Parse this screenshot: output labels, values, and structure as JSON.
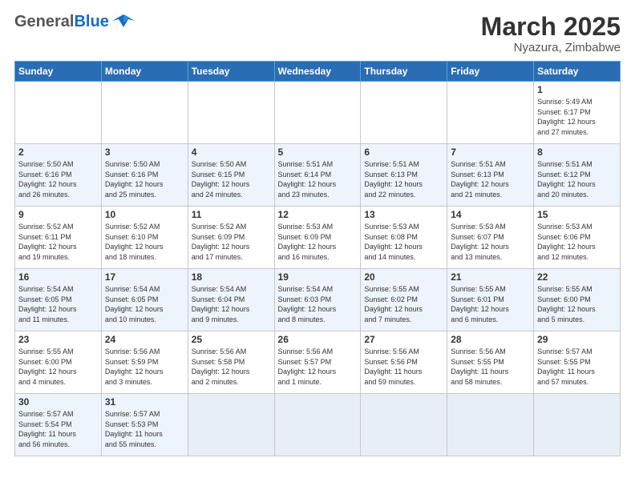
{
  "header": {
    "logo_general": "General",
    "logo_blue": "Blue",
    "title": "March 2025",
    "location": "Nyazura, Zimbabwe"
  },
  "weekdays": [
    "Sunday",
    "Monday",
    "Tuesday",
    "Wednesday",
    "Thursday",
    "Friday",
    "Saturday"
  ],
  "weeks": [
    [
      {
        "day": "",
        "info": ""
      },
      {
        "day": "",
        "info": ""
      },
      {
        "day": "",
        "info": ""
      },
      {
        "day": "",
        "info": ""
      },
      {
        "day": "",
        "info": ""
      },
      {
        "day": "",
        "info": ""
      },
      {
        "day": "1",
        "info": "Sunrise: 5:49 AM\nSunset: 6:17 PM\nDaylight: 12 hours\nand 27 minutes."
      }
    ],
    [
      {
        "day": "2",
        "info": "Sunrise: 5:50 AM\nSunset: 6:16 PM\nDaylight: 12 hours\nand 26 minutes."
      },
      {
        "day": "3",
        "info": "Sunrise: 5:50 AM\nSunset: 6:16 PM\nDaylight: 12 hours\nand 25 minutes."
      },
      {
        "day": "4",
        "info": "Sunrise: 5:50 AM\nSunset: 6:15 PM\nDaylight: 12 hours\nand 24 minutes."
      },
      {
        "day": "5",
        "info": "Sunrise: 5:51 AM\nSunset: 6:14 PM\nDaylight: 12 hours\nand 23 minutes."
      },
      {
        "day": "6",
        "info": "Sunrise: 5:51 AM\nSunset: 6:13 PM\nDaylight: 12 hours\nand 22 minutes."
      },
      {
        "day": "7",
        "info": "Sunrise: 5:51 AM\nSunset: 6:13 PM\nDaylight: 12 hours\nand 21 minutes."
      },
      {
        "day": "8",
        "info": "Sunrise: 5:51 AM\nSunset: 6:12 PM\nDaylight: 12 hours\nand 20 minutes."
      }
    ],
    [
      {
        "day": "9",
        "info": "Sunrise: 5:52 AM\nSunset: 6:11 PM\nDaylight: 12 hours\nand 19 minutes."
      },
      {
        "day": "10",
        "info": "Sunrise: 5:52 AM\nSunset: 6:10 PM\nDaylight: 12 hours\nand 18 minutes."
      },
      {
        "day": "11",
        "info": "Sunrise: 5:52 AM\nSunset: 6:09 PM\nDaylight: 12 hours\nand 17 minutes."
      },
      {
        "day": "12",
        "info": "Sunrise: 5:53 AM\nSunset: 6:09 PM\nDaylight: 12 hours\nand 16 minutes."
      },
      {
        "day": "13",
        "info": "Sunrise: 5:53 AM\nSunset: 6:08 PM\nDaylight: 12 hours\nand 14 minutes."
      },
      {
        "day": "14",
        "info": "Sunrise: 5:53 AM\nSunset: 6:07 PM\nDaylight: 12 hours\nand 13 minutes."
      },
      {
        "day": "15",
        "info": "Sunrise: 5:53 AM\nSunset: 6:06 PM\nDaylight: 12 hours\nand 12 minutes."
      }
    ],
    [
      {
        "day": "16",
        "info": "Sunrise: 5:54 AM\nSunset: 6:05 PM\nDaylight: 12 hours\nand 11 minutes."
      },
      {
        "day": "17",
        "info": "Sunrise: 5:54 AM\nSunset: 6:05 PM\nDaylight: 12 hours\nand 10 minutes."
      },
      {
        "day": "18",
        "info": "Sunrise: 5:54 AM\nSunset: 6:04 PM\nDaylight: 12 hours\nand 9 minutes."
      },
      {
        "day": "19",
        "info": "Sunrise: 5:54 AM\nSunset: 6:03 PM\nDaylight: 12 hours\nand 8 minutes."
      },
      {
        "day": "20",
        "info": "Sunrise: 5:55 AM\nSunset: 6:02 PM\nDaylight: 12 hours\nand 7 minutes."
      },
      {
        "day": "21",
        "info": "Sunrise: 5:55 AM\nSunset: 6:01 PM\nDaylight: 12 hours\nand 6 minutes."
      },
      {
        "day": "22",
        "info": "Sunrise: 5:55 AM\nSunset: 6:00 PM\nDaylight: 12 hours\nand 5 minutes."
      }
    ],
    [
      {
        "day": "23",
        "info": "Sunrise: 5:55 AM\nSunset: 6:00 PM\nDaylight: 12 hours\nand 4 minutes."
      },
      {
        "day": "24",
        "info": "Sunrise: 5:56 AM\nSunset: 5:59 PM\nDaylight: 12 hours\nand 3 minutes."
      },
      {
        "day": "25",
        "info": "Sunrise: 5:56 AM\nSunset: 5:58 PM\nDaylight: 12 hours\nand 2 minutes."
      },
      {
        "day": "26",
        "info": "Sunrise: 5:56 AM\nSunset: 5:57 PM\nDaylight: 12 hours\nand 1 minute."
      },
      {
        "day": "27",
        "info": "Sunrise: 5:56 AM\nSunset: 5:56 PM\nDaylight: 11 hours\nand 59 minutes."
      },
      {
        "day": "28",
        "info": "Sunrise: 5:56 AM\nSunset: 5:55 PM\nDaylight: 11 hours\nand 58 minutes."
      },
      {
        "day": "29",
        "info": "Sunrise: 5:57 AM\nSunset: 5:55 PM\nDaylight: 11 hours\nand 57 minutes."
      }
    ],
    [
      {
        "day": "30",
        "info": "Sunrise: 5:57 AM\nSunset: 5:54 PM\nDaylight: 11 hours\nand 56 minutes."
      },
      {
        "day": "31",
        "info": "Sunrise: 5:57 AM\nSunset: 5:53 PM\nDaylight: 11 hours\nand 55 minutes."
      },
      {
        "day": "",
        "info": ""
      },
      {
        "day": "",
        "info": ""
      },
      {
        "day": "",
        "info": ""
      },
      {
        "day": "",
        "info": ""
      },
      {
        "day": "",
        "info": ""
      }
    ]
  ]
}
